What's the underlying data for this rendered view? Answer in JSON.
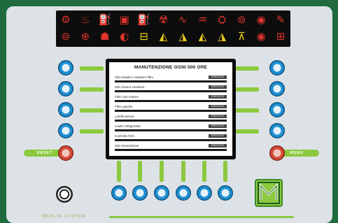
{
  "icons": {
    "row1": [
      {
        "name": "engine-icon",
        "glyph": "⚙",
        "color": "red"
      },
      {
        "name": "coolant-temp-icon",
        "glyph": "♨",
        "color": "red"
      },
      {
        "name": "oil-pressure-icon",
        "glyph": "⛽",
        "color": "red"
      },
      {
        "name": "battery-charge-icon",
        "glyph": "▣",
        "color": "red"
      },
      {
        "name": "fuel-level-icon",
        "glyph": "⛽",
        "color": "yel"
      },
      {
        "name": "air-filter-icon",
        "glyph": "☢",
        "color": "red"
      },
      {
        "name": "glow-plug-icon",
        "glyph": "∿",
        "color": "red"
      },
      {
        "name": "hydraulic-oil-icon",
        "glyph": "♒",
        "color": "red"
      },
      {
        "name": "transmission-icon",
        "glyph": "⛭",
        "color": "red"
      },
      {
        "name": "brake-icon",
        "glyph": "⊚",
        "color": "red"
      },
      {
        "name": "parking-icon",
        "glyph": "◉",
        "color": "red"
      },
      {
        "name": "wrench-warning-icon",
        "glyph": "✎",
        "color": "red"
      }
    ],
    "row2": [
      {
        "name": "brake-warning-icon",
        "glyph": "⊜",
        "color": "red"
      },
      {
        "name": "steering-icon",
        "glyph": "⊕",
        "color": "red"
      },
      {
        "name": "seat-belt-icon",
        "glyph": "☗",
        "color": "red"
      },
      {
        "name": "light-icon",
        "glyph": "◐",
        "color": "red"
      },
      {
        "name": "lock-icon",
        "glyph": "⊟",
        "color": "yel"
      },
      {
        "name": "load-icon",
        "glyph": "◭",
        "color": "yel"
      },
      {
        "name": "tilt-icon",
        "glyph": "◮",
        "color": "yel"
      },
      {
        "name": "stabilizer-icon",
        "glyph": "◭",
        "color": "yel"
      },
      {
        "name": "boom-icon",
        "glyph": "◮",
        "color": "yel"
      },
      {
        "name": "outrigger-icon",
        "glyph": "⊼",
        "color": "yel"
      },
      {
        "name": "horn-icon",
        "glyph": "◉",
        "color": "red"
      },
      {
        "name": "hazard-icon",
        "glyph": "⊞",
        "color": "red"
      }
    ]
  },
  "screen": {
    "title": "MANUTENZIONE OGNI 500 ORE",
    "rows": [
      {
        "label": "Olio idraulico sostituire filtro",
        "tag": "ESEGUITO"
      },
      {
        "label": "Olio motore sostituire",
        "tag": "ESEGUITO"
      },
      {
        "label": "Filtro aria motore",
        "tag": "ESEGUITO"
      },
      {
        "label": "Filtro gasolio",
        "tag": "ESEGUITO"
      },
      {
        "label": "Lubrificazione",
        "tag": "ESEGUITO"
      },
      {
        "label": "Livello refrigerante",
        "tag": "ESEGUITO"
      },
      {
        "label": "Controllo freni",
        "tag": "ESEGUITO"
      },
      {
        "label": "Olio trasmissione",
        "tag": "ESEGUITO"
      }
    ]
  },
  "buttons": {
    "reset_label": "RESET",
    "menu_label": "MENU"
  },
  "footer": {
    "brand_text": "MERLIN SYSTEM"
  },
  "colors": {
    "background": "#1f6b3e",
    "panel": "#dde2e7",
    "accent_green": "#8cc93f",
    "button_blue": "#1e8fd0",
    "button_red": "#d24a35",
    "icon_red": "#e0342b",
    "icon_yellow": "#f2d21a"
  }
}
